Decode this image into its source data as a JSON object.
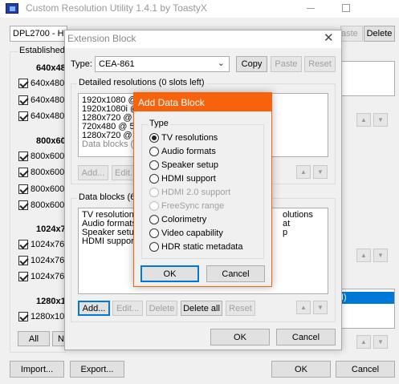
{
  "main_window": {
    "title": "Custom Resolution Utility 1.4.1 by ToastyX",
    "monitor_select": "DPL2700 - HD",
    "paste_label": "aste",
    "delete_label": "Delete",
    "established_label": "Established",
    "groups": [
      {
        "head": "640x48",
        "items": [
          "640x480",
          "640x480",
          "640x480"
        ]
      },
      {
        "head": "800x60",
        "items": [
          "800x600",
          "800x600",
          "800x600",
          "800x600"
        ]
      },
      {
        "head": "1024x7",
        "items": [
          "1024x76",
          "1024x76",
          "1024x76"
        ]
      },
      {
        "head": "1280x1",
        "items": [
          "1280x10"
        ]
      }
    ],
    "all_label": "All",
    "none_label": "N",
    "right_list_partial": "I)",
    "import_label": "Import...",
    "export_label": "Export...",
    "ok_label": "OK",
    "cancel_label": "Cancel"
  },
  "extension_block": {
    "title": "Extension Block",
    "type_label": "Type:",
    "type_value": "CEA-861",
    "copy_label": "Copy",
    "paste_label": "Paste",
    "reset_label": "Reset",
    "detailed_header": "Detailed resolutions (0 slots left)",
    "detailed_items": [
      "1920x1080 @",
      "1920x1080i @",
      "1280x720 @ 6",
      "720x480 @ 59",
      "1280x720 @ 5"
    ],
    "detailed_footer": "Data blocks (1",
    "detailed_buttons": [
      "Add...",
      "Edit..."
    ],
    "data_blocks_header": "Data blocks (6",
    "data_items_left": [
      "TV resolutions",
      "Audio formats",
      "Speaker setup",
      "HDMI support"
    ],
    "data_items_right": [
      "olutions",
      "at",
      "p"
    ],
    "data_buttons": {
      "add": "Add...",
      "edit": "Edit...",
      "delete": "Delete",
      "delete_all": "Delete all",
      "reset": "Reset"
    },
    "ok_label": "OK",
    "cancel_label": "Cancel"
  },
  "add_data_block": {
    "title": "Add Data Block",
    "type_label": "Type",
    "options": [
      {
        "label": "TV resolutions",
        "checked": true,
        "enabled": true
      },
      {
        "label": "Audio formats",
        "checked": false,
        "enabled": true
      },
      {
        "label": "Speaker setup",
        "checked": false,
        "enabled": true
      },
      {
        "label": "HDMI support",
        "checked": false,
        "enabled": true
      },
      {
        "label": "HDMI 2.0 support",
        "checked": false,
        "enabled": false
      },
      {
        "label": "FreeSync range",
        "checked": false,
        "enabled": false
      },
      {
        "label": "Colorimetry",
        "checked": false,
        "enabled": true
      },
      {
        "label": "Video capability",
        "checked": false,
        "enabled": true
      },
      {
        "label": "HDR static metadata",
        "checked": false,
        "enabled": true
      }
    ],
    "ok_label": "OK",
    "cancel_label": "Cancel",
    "accent_color": "#f7630c"
  }
}
